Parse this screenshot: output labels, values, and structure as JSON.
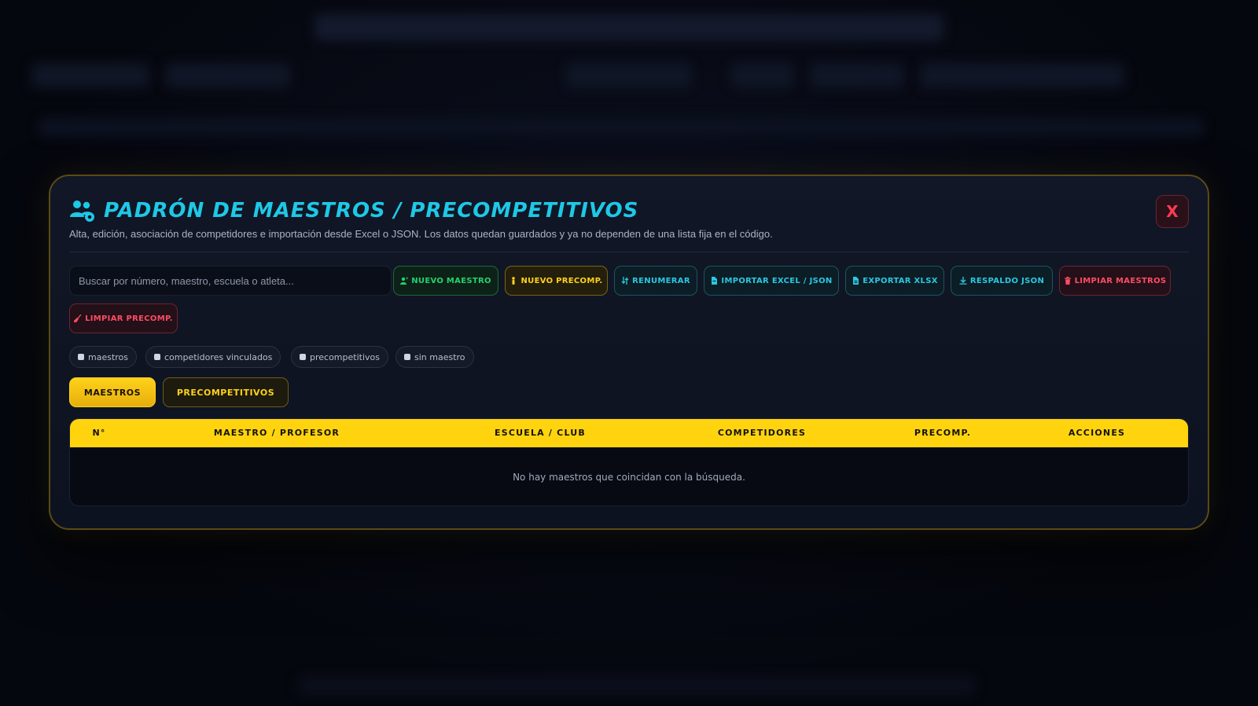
{
  "modal": {
    "title": "PADRÓN DE MAESTROS / PRECOMPETITIVOS",
    "subtitle": "Alta, edición, asociación de competidores e importación desde Excel o JSON. Los datos quedan guardados y ya no dependen de una lista fija en el código.",
    "close_label": "X"
  },
  "search": {
    "placeholder": "Buscar por número, maestro, escuela o atleta..."
  },
  "toolbar": {
    "new_master": "NUEVO MAESTRO",
    "new_precomp": "NUEVO PRECOMP.",
    "renumber": "RENUMERAR",
    "import": "IMPORTAR EXCEL / JSON",
    "export": "EXPORTAR XLSX",
    "backup": "RESPALDO JSON",
    "clear_masters": "LIMPIAR MAESTROS",
    "clear_precomp": "LIMPIAR PRECOMP."
  },
  "chips": [
    {
      "label": "maestros"
    },
    {
      "label": "competidores vinculados"
    },
    {
      "label": "precompetitivos"
    },
    {
      "label": "sin maestro"
    }
  ],
  "tabs": [
    {
      "label": "MAESTROS",
      "active": true
    },
    {
      "label": "PRECOMPETITIVOS",
      "active": false
    }
  ],
  "table": {
    "columns": [
      "N°",
      "MAESTRO / PROFESOR",
      "ESCUELA / CLUB",
      "COMPETIDORES",
      "PRECOMP.",
      "ACCIONES"
    ],
    "empty_message": "No hay maestros que coincidan con la búsqueda."
  },
  "colors": {
    "accent_cyan": "#1ec8e6",
    "accent_yellow": "#ffd40f",
    "accent_green": "#22d36c",
    "accent_red": "#ff4c63"
  },
  "icons": {
    "title": "users-gear-icon",
    "new_master": "user-plus-icon",
    "new_precomp": "child-icon",
    "renumber": "sort-icon",
    "import": "file-import-icon",
    "export": "file-export-icon",
    "backup": "download-icon",
    "clear_masters": "trash-icon",
    "clear_precomp": "broom-icon"
  }
}
